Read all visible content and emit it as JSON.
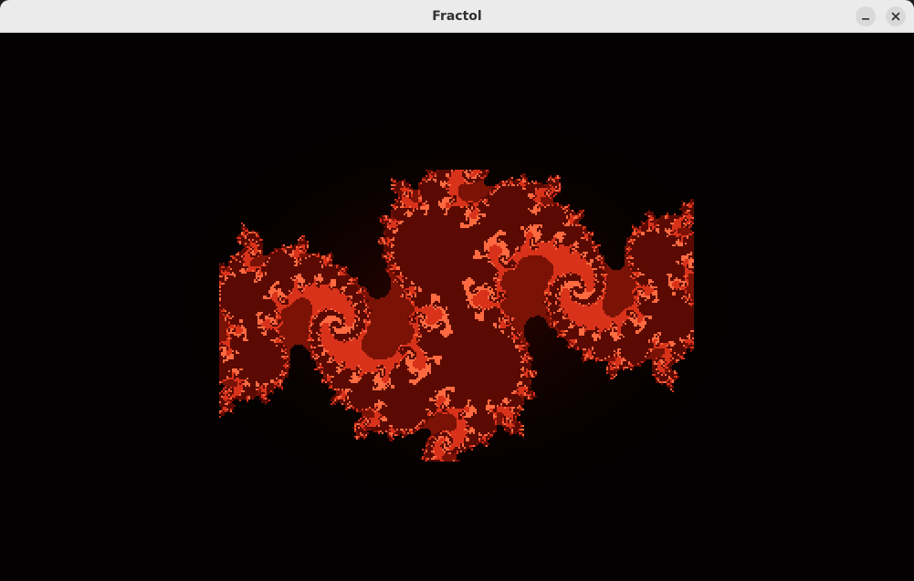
{
  "window": {
    "title": "Fractol",
    "minimize_icon": "minimize-icon",
    "close_icon": "close-icon"
  },
  "fractal": {
    "palette": {
      "background": "#030101",
      "glow": "#3a0500",
      "body": "#d8321a",
      "highlight": "#ff6a40",
      "dark": "#5a0a02"
    }
  }
}
